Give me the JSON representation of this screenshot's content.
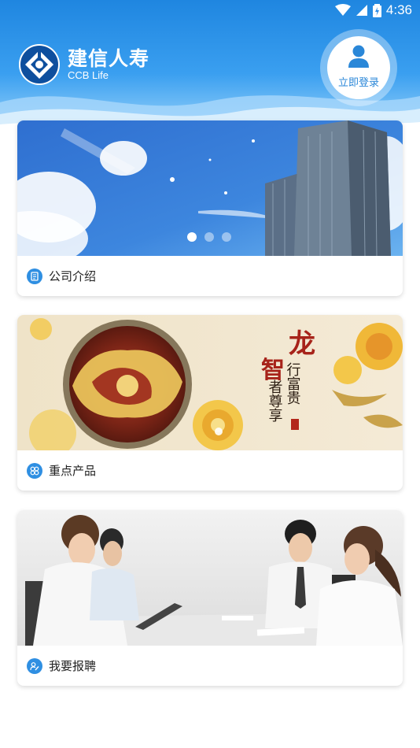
{
  "status_bar": {
    "time": "4:36"
  },
  "header": {
    "logo_cn": "建信人寿",
    "logo_en": "CCB Life",
    "login_label": "立即登录"
  },
  "colors": {
    "brand_blue": "#2a87d8",
    "header_blue": "#1f86e0"
  },
  "cards": [
    {
      "label": "公司介绍",
      "icon": "document-icon"
    },
    {
      "label": "重点产品",
      "icon": "product-icon"
    },
    {
      "label": "我要报聘",
      "icon": "recruit-icon"
    }
  ],
  "banner": {
    "slides": 3,
    "active_slide": 1
  },
  "product_banner": {
    "title_lines": [
      "龙",
      "行富贵",
      "智",
      "者尊享"
    ]
  }
}
